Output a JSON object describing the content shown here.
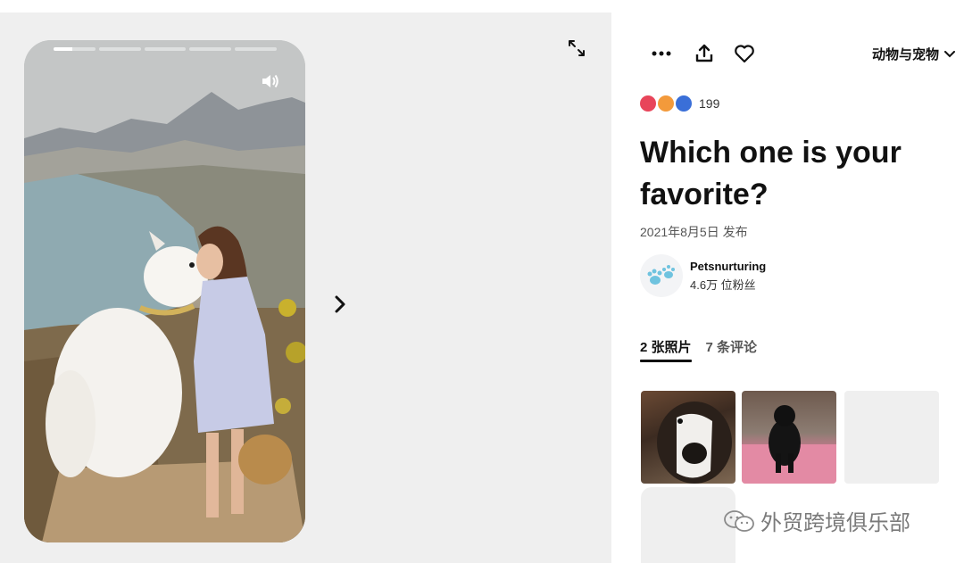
{
  "viewer": {
    "progress": {
      "segments": 5,
      "current_index": 0,
      "current_fraction": 0.45
    },
    "volume_icon": "volume-icon",
    "expand_icon": "expand-icon",
    "next_icon": "chevron-right-icon"
  },
  "toolbar": {
    "more_icon": "more-dots-icon",
    "share_icon": "share-icon",
    "like_icon": "heart-icon",
    "category": "动物与宠物",
    "category_icon": "chevron-down-icon"
  },
  "reactions": {
    "icons": [
      "love-reaction-icon",
      "wow-reaction-icon",
      "haha-reaction-icon"
    ],
    "count": "199"
  },
  "pin": {
    "title": "Which one is your favorite?",
    "date": "2021年8月5日 发布"
  },
  "creator": {
    "name": "Petsnurturing",
    "followers": "4.6万 位粉丝"
  },
  "tabs": [
    {
      "label": "2 张照片",
      "active": true
    },
    {
      "label": "7 条评论",
      "active": false
    }
  ],
  "watermark": {
    "text": "外贸跨境俱乐部"
  },
  "colors": {
    "accent": "#111111",
    "pane_bg": "#efefef"
  }
}
